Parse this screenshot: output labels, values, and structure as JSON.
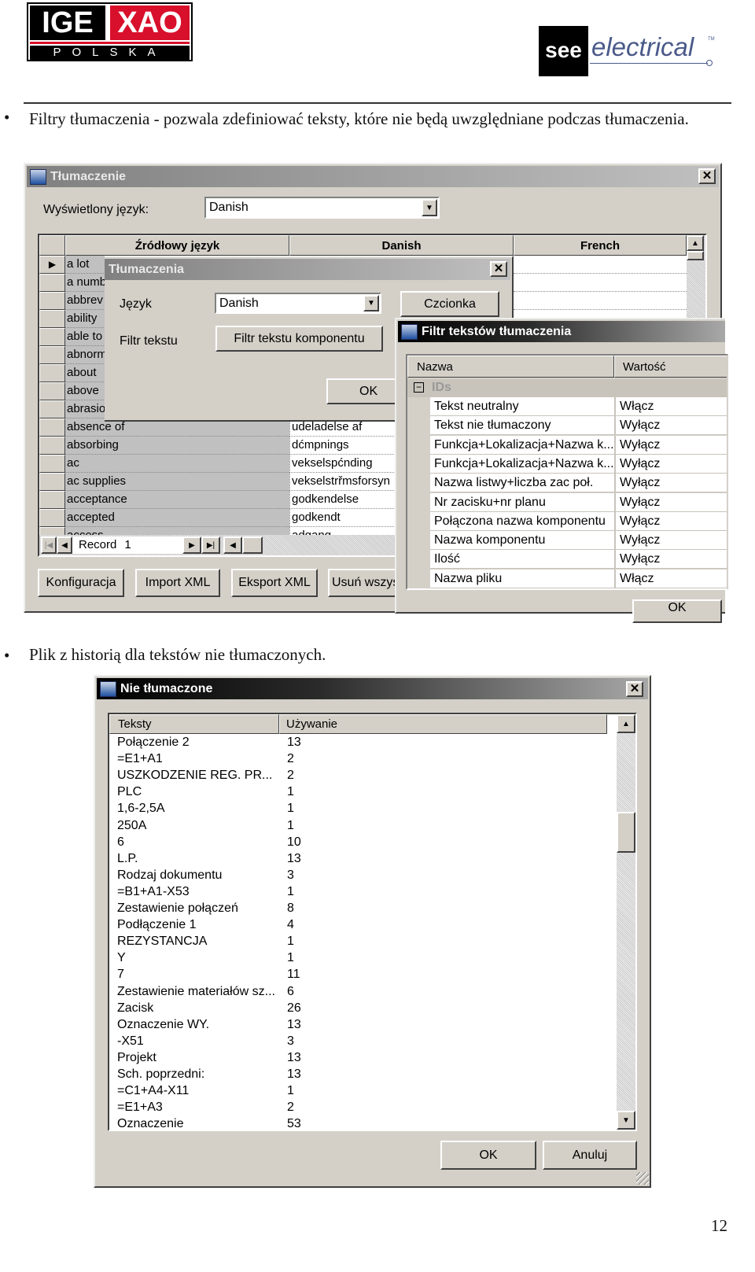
{
  "header": {
    "logo_left": {
      "text_top_left": "IGE",
      "text_top_right": "XAO",
      "text_bottom": "POLSKA"
    },
    "logo_right": {
      "mark": "see",
      "text": "electrical",
      "tm": "TM"
    }
  },
  "bullets": [
    "Filtry tłumaczenia - pozwala zdefiniować teksty, które nie będą uwzględniane podczas tłumaczenia.",
    "Plik z historią dla tekstów nie tłumaczonych."
  ],
  "dialog_translation": {
    "title": "Tłumaczenie",
    "display_language_label": "Wyświetlony język:",
    "display_language_value": "Danish",
    "columns": [
      "Źródłowy język",
      "Danish",
      "French"
    ],
    "rows": [
      {
        "source": "a lot",
        "danish": ""
      },
      {
        "source": "a numb",
        "danish": ""
      },
      {
        "source": "abbrev",
        "danish": ""
      },
      {
        "source": "ability",
        "danish": ""
      },
      {
        "source": "able to",
        "danish": ""
      },
      {
        "source": "abnorm",
        "danish": ""
      },
      {
        "source": "about",
        "danish": ""
      },
      {
        "source": "above",
        "danish": ""
      },
      {
        "source": "abrasio",
        "danish": ""
      },
      {
        "source": "absence of",
        "danish": "udeladelse af"
      },
      {
        "source": "absorbing",
        "danish": "dćmpnings"
      },
      {
        "source": "ac",
        "danish": "vekselspćnding"
      },
      {
        "source": "ac supplies",
        "danish": "vekselstrřmsforsyn"
      },
      {
        "source": "acceptance",
        "danish": "godkendelse"
      },
      {
        "source": "accepted",
        "danish": "godkendt"
      },
      {
        "source": "access",
        "danish": "adgang"
      }
    ],
    "record_label": "Record",
    "record_value": "1",
    "buttons": [
      "Konfiguracja",
      "Import XML",
      "Eksport XML",
      "Usuń wszys"
    ]
  },
  "dialog_translations": {
    "title": "Tłumaczenia",
    "language_label": "Język",
    "language_value": "Danish",
    "font_button": "Czcionka",
    "text_filter_label": "Filtr tekstu",
    "text_filter_button": "Filtr tekstu komponentu",
    "ok": "OK"
  },
  "dialog_filter": {
    "title": "Filtr tekstów tłumaczenia",
    "columns": [
      "Nazwa",
      "Wartość"
    ],
    "group": "IDs",
    "rows": [
      {
        "name": "Tekst neutralny",
        "value": "Włącz"
      },
      {
        "name": "Tekst nie tłumaczony",
        "value": "Wyłącz"
      },
      {
        "name": "Funkcja+Lokalizacja+Nazwa k...",
        "value": "Wyłącz"
      },
      {
        "name": "Funkcja+Lokalizacja+Nazwa k...",
        "value": "Wyłącz"
      },
      {
        "name": "Nazwa listwy+liczba zac poł.",
        "value": "Wyłącz"
      },
      {
        "name": "Nr zacisku+nr planu",
        "value": "Wyłącz"
      },
      {
        "name": "Połączona nazwa komponentu",
        "value": "Wyłącz"
      },
      {
        "name": "Nazwa komponentu",
        "value": "Wyłącz"
      },
      {
        "name": "Ilość",
        "value": "Wyłącz"
      },
      {
        "name": "Nazwa pliku",
        "value": "Włącz"
      }
    ],
    "ok": "OK"
  },
  "dialog_untranslated": {
    "title": "Nie tłumaczone",
    "columns": [
      "Teksty",
      "Używanie"
    ],
    "rows": [
      {
        "text": "Połączenie 2",
        "count": "13"
      },
      {
        "text": "=E1+A1",
        "count": "2"
      },
      {
        "text": "USZKODZENIE REG. PR...",
        "count": "2"
      },
      {
        "text": "PLC",
        "count": "1"
      },
      {
        "text": "1,6-2,5A",
        "count": "1"
      },
      {
        "text": "250A",
        "count": "1"
      },
      {
        "text": "6",
        "count": "10"
      },
      {
        "text": "L.P.",
        "count": "13"
      },
      {
        "text": "Rodzaj dokumentu",
        "count": "3"
      },
      {
        "text": "=B1+A1-X53",
        "count": "1"
      },
      {
        "text": "Zestawienie połączeń",
        "count": "8"
      },
      {
        "text": "Podłączenie 1",
        "count": "4"
      },
      {
        "text": "REZYSTANCJA",
        "count": "1"
      },
      {
        "text": "Y",
        "count": "1"
      },
      {
        "text": "7",
        "count": "11"
      },
      {
        "text": "Zestawienie materiałów sz...",
        "count": "6"
      },
      {
        "text": "Zacisk",
        "count": "26"
      },
      {
        "text": "Oznaczenie WY.",
        "count": "13"
      },
      {
        "text": "-X51",
        "count": "3"
      },
      {
        "text": "Projekt",
        "count": "13"
      },
      {
        "text": "Sch. poprzedni:",
        "count": "13"
      },
      {
        "text": "=C1+A4-X11",
        "count": "1"
      },
      {
        "text": "=E1+A3",
        "count": "2"
      },
      {
        "text": "Oznaczenie",
        "count": "53"
      }
    ],
    "ok": "OK",
    "cancel": "Anuluj"
  },
  "page_number": "12"
}
